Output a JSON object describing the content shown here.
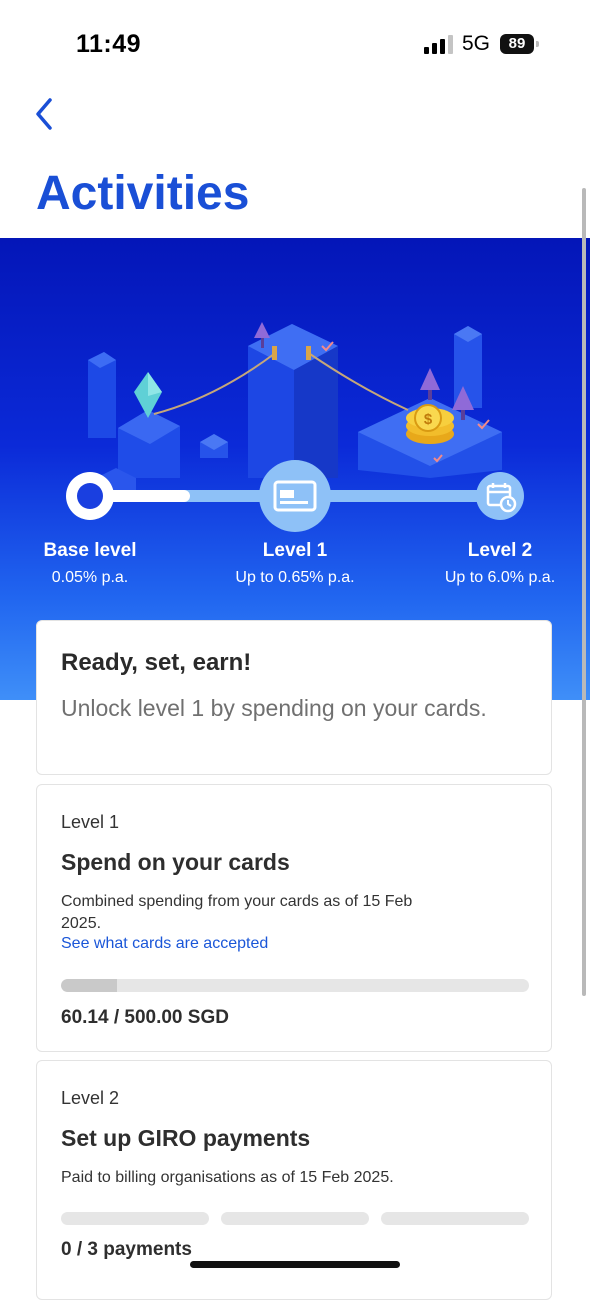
{
  "status": {
    "time": "11:49",
    "network": "5G",
    "battery": "89"
  },
  "header": {
    "title": "Activities"
  },
  "levels": [
    {
      "name": "Base level",
      "rate": "0.05% p.a."
    },
    {
      "name": "Level 1",
      "rate": "Up to 0.65% p.a."
    },
    {
      "name": "Level 2",
      "rate": "Up to 6.0% p.a."
    }
  ],
  "progress_track": {
    "current_level": "Base level"
  },
  "hero_card": {
    "title": "Ready, set, earn!",
    "subtitle": "Unlock level 1 by spending on your cards."
  },
  "level1_card": {
    "eyebrow": "Level 1",
    "title": "Spend on your cards",
    "description": "Combined spending from your cards as of 15 Feb 2025.",
    "link": "See what cards are accepted",
    "progress_fraction": 0.12,
    "value_text": "60.14 / 500.00 SGD"
  },
  "level2_card": {
    "eyebrow": "Level 2",
    "title": "Set up GIRO payments",
    "description": "Paid to billing organisations as of 15 Feb 2025.",
    "segments_done": 0,
    "segments_total": 3,
    "value_text": "0 / 3 payments"
  },
  "colors": {
    "accent": "#1a4fd6",
    "hero_top": "#0416b8",
    "hero_bottom": "#3f8ff8",
    "link": "#1a56d8"
  },
  "icons": [
    "back-chevron-icon",
    "card-icon",
    "calendar-clock-icon",
    "signal-icon",
    "battery-icon"
  ]
}
